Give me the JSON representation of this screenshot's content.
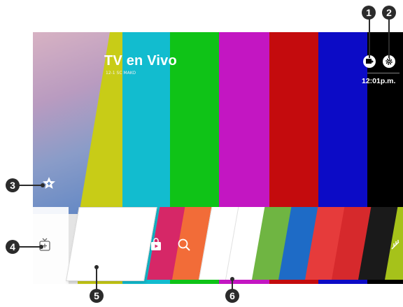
{
  "screen": {
    "channel_title": "TV en Vivo",
    "channel_subtitle": "12-1 SC MAKO",
    "clock": "12:01p.m."
  },
  "colors": {
    "bars": [
      "#e4e4e4",
      "#c8cc17",
      "#12bccf",
      "#0fc317",
      "#c316c2",
      "#c40b0d",
      "#0c0bc6",
      "#000000"
    ]
  },
  "icons": {
    "input_icon": "input-source-icon",
    "settings_icon": "gear-icon",
    "favorite_icon": "star-plus-icon",
    "add_icon": "add-tv-icon",
    "store_icon": "store-icon",
    "search_icon": "search-icon",
    "antenna_icon": "antenna-icon"
  },
  "launcher": {
    "tiles": [
      {
        "name": "app-tile-store",
        "color": "#d62767"
      },
      {
        "name": "app-tile-search",
        "color": "#f26c38"
      },
      {
        "name": "app-tile-blank-1",
        "color": "#ffffff"
      },
      {
        "name": "app-tile-blank-2",
        "color": "#ffffff"
      },
      {
        "name": "app-tile-green",
        "color": "#6fb542"
      },
      {
        "name": "app-tile-blue",
        "color": "#1e6bc6"
      },
      {
        "name": "app-tile-red-1",
        "color": "#e63b3b"
      },
      {
        "name": "app-tile-red-2",
        "color": "#d6292c"
      },
      {
        "name": "app-tile-black",
        "color": "#1a1a1a"
      },
      {
        "name": "app-tile-antenna",
        "color": "#a6c21a"
      }
    ]
  },
  "callouts": {
    "one": "1",
    "two": "2",
    "three": "3",
    "four": "4",
    "five": "5",
    "six": "6"
  }
}
